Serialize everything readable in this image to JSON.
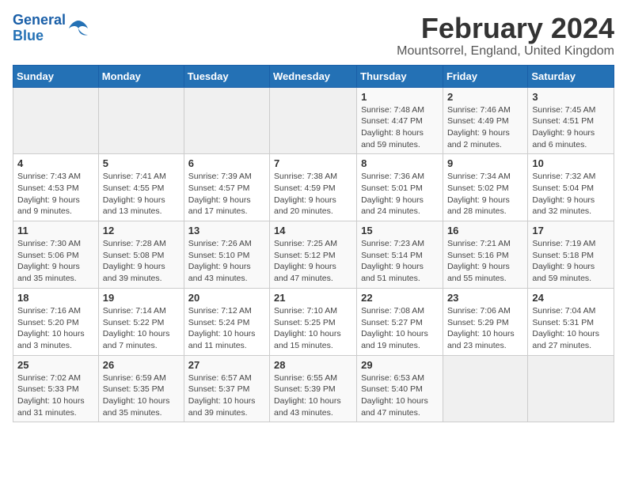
{
  "header": {
    "logo_line1": "General",
    "logo_line2": "Blue",
    "title": "February 2024",
    "subtitle": "Mountsorrel, England, United Kingdom"
  },
  "days_of_week": [
    "Sunday",
    "Monday",
    "Tuesday",
    "Wednesday",
    "Thursday",
    "Friday",
    "Saturday"
  ],
  "weeks": [
    [
      {
        "day": "",
        "info": ""
      },
      {
        "day": "",
        "info": ""
      },
      {
        "day": "",
        "info": ""
      },
      {
        "day": "",
        "info": ""
      },
      {
        "day": "1",
        "info": "Sunrise: 7:48 AM\nSunset: 4:47 PM\nDaylight: 8 hours\nand 59 minutes."
      },
      {
        "day": "2",
        "info": "Sunrise: 7:46 AM\nSunset: 4:49 PM\nDaylight: 9 hours\nand 2 minutes."
      },
      {
        "day": "3",
        "info": "Sunrise: 7:45 AM\nSunset: 4:51 PM\nDaylight: 9 hours\nand 6 minutes."
      }
    ],
    [
      {
        "day": "4",
        "info": "Sunrise: 7:43 AM\nSunset: 4:53 PM\nDaylight: 9 hours\nand 9 minutes."
      },
      {
        "day": "5",
        "info": "Sunrise: 7:41 AM\nSunset: 4:55 PM\nDaylight: 9 hours\nand 13 minutes."
      },
      {
        "day": "6",
        "info": "Sunrise: 7:39 AM\nSunset: 4:57 PM\nDaylight: 9 hours\nand 17 minutes."
      },
      {
        "day": "7",
        "info": "Sunrise: 7:38 AM\nSunset: 4:59 PM\nDaylight: 9 hours\nand 20 minutes."
      },
      {
        "day": "8",
        "info": "Sunrise: 7:36 AM\nSunset: 5:01 PM\nDaylight: 9 hours\nand 24 minutes."
      },
      {
        "day": "9",
        "info": "Sunrise: 7:34 AM\nSunset: 5:02 PM\nDaylight: 9 hours\nand 28 minutes."
      },
      {
        "day": "10",
        "info": "Sunrise: 7:32 AM\nSunset: 5:04 PM\nDaylight: 9 hours\nand 32 minutes."
      }
    ],
    [
      {
        "day": "11",
        "info": "Sunrise: 7:30 AM\nSunset: 5:06 PM\nDaylight: 9 hours\nand 35 minutes."
      },
      {
        "day": "12",
        "info": "Sunrise: 7:28 AM\nSunset: 5:08 PM\nDaylight: 9 hours\nand 39 minutes."
      },
      {
        "day": "13",
        "info": "Sunrise: 7:26 AM\nSunset: 5:10 PM\nDaylight: 9 hours\nand 43 minutes."
      },
      {
        "day": "14",
        "info": "Sunrise: 7:25 AM\nSunset: 5:12 PM\nDaylight: 9 hours\nand 47 minutes."
      },
      {
        "day": "15",
        "info": "Sunrise: 7:23 AM\nSunset: 5:14 PM\nDaylight: 9 hours\nand 51 minutes."
      },
      {
        "day": "16",
        "info": "Sunrise: 7:21 AM\nSunset: 5:16 PM\nDaylight: 9 hours\nand 55 minutes."
      },
      {
        "day": "17",
        "info": "Sunrise: 7:19 AM\nSunset: 5:18 PM\nDaylight: 9 hours\nand 59 minutes."
      }
    ],
    [
      {
        "day": "18",
        "info": "Sunrise: 7:16 AM\nSunset: 5:20 PM\nDaylight: 10 hours\nand 3 minutes."
      },
      {
        "day": "19",
        "info": "Sunrise: 7:14 AM\nSunset: 5:22 PM\nDaylight: 10 hours\nand 7 minutes."
      },
      {
        "day": "20",
        "info": "Sunrise: 7:12 AM\nSunset: 5:24 PM\nDaylight: 10 hours\nand 11 minutes."
      },
      {
        "day": "21",
        "info": "Sunrise: 7:10 AM\nSunset: 5:25 PM\nDaylight: 10 hours\nand 15 minutes."
      },
      {
        "day": "22",
        "info": "Sunrise: 7:08 AM\nSunset: 5:27 PM\nDaylight: 10 hours\nand 19 minutes."
      },
      {
        "day": "23",
        "info": "Sunrise: 7:06 AM\nSunset: 5:29 PM\nDaylight: 10 hours\nand 23 minutes."
      },
      {
        "day": "24",
        "info": "Sunrise: 7:04 AM\nSunset: 5:31 PM\nDaylight: 10 hours\nand 27 minutes."
      }
    ],
    [
      {
        "day": "25",
        "info": "Sunrise: 7:02 AM\nSunset: 5:33 PM\nDaylight: 10 hours\nand 31 minutes."
      },
      {
        "day": "26",
        "info": "Sunrise: 6:59 AM\nSunset: 5:35 PM\nDaylight: 10 hours\nand 35 minutes."
      },
      {
        "day": "27",
        "info": "Sunrise: 6:57 AM\nSunset: 5:37 PM\nDaylight: 10 hours\nand 39 minutes."
      },
      {
        "day": "28",
        "info": "Sunrise: 6:55 AM\nSunset: 5:39 PM\nDaylight: 10 hours\nand 43 minutes."
      },
      {
        "day": "29",
        "info": "Sunrise: 6:53 AM\nSunset: 5:40 PM\nDaylight: 10 hours\nand 47 minutes."
      },
      {
        "day": "",
        "info": ""
      },
      {
        "day": "",
        "info": ""
      }
    ]
  ]
}
